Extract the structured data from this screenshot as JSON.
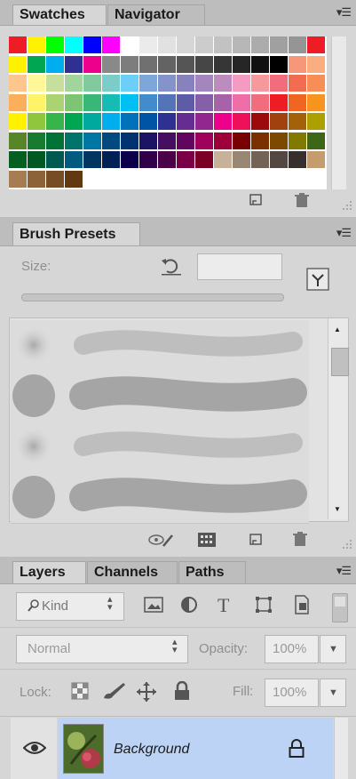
{
  "swatches_panel": {
    "tabs": [
      {
        "label": "Swatches"
      },
      {
        "label": "Navigator"
      }
    ],
    "menu_icon": "panel-menu-icon",
    "footer_icons": [
      "new-swatch-icon",
      "trash-icon"
    ],
    "colors": [
      [
        "#ee1c24",
        "#fff200",
        "#00ff00",
        "#00ffff",
        "#0000ff",
        "#ff00ff",
        "#ffffff",
        "#ebebeb",
        "#e1e1e1",
        "#d6d6d6",
        "#cccccc",
        "#c2c2c2",
        "#b7b7b7",
        "#acacac",
        "#a0a0a0",
        "#959595",
        "#ee1c24"
      ],
      [
        "#fff200",
        "#00a651",
        "#00aeef",
        "#2e3192",
        "#ec008c",
        "#898989",
        "#7d7d7d",
        "#707070",
        "#636363",
        "#555555",
        "#464646",
        "#363636",
        "#262626",
        "#111111",
        "#000000",
        "#f7977a",
        "#fbad82"
      ],
      [
        "#fdc68c",
        "#fff799",
        "#c6df9c",
        "#a4d49d",
        "#81ca9d",
        "#7bcdc9",
        "#6ccff7",
        "#7da7d8",
        "#8493ca",
        "#8781bd",
        "#a286bd",
        "#bc8cbf",
        "#f49bc1",
        "#f5999d",
        "#f16d7e",
        "#f26c4f",
        "#f68e55"
      ],
      [
        "#fbaf5a",
        "#fff467",
        "#acd372",
        "#7dc473",
        "#39b778",
        "#16bcb4",
        "#00bff3",
        "#438ccb",
        "#5573b7",
        "#5e5ca7",
        "#855fa8",
        "#a763a9",
        "#ef6ea8",
        "#f16d7e",
        "#ee1d24",
        "#f16522",
        "#f7941d"
      ],
      [
        "#fff100",
        "#8fc63d",
        "#37b44a",
        "#00a650",
        "#00a99e",
        "#00aeef",
        "#0072bc",
        "#0054a5",
        "#2f3192",
        "#652c91",
        "#91278f",
        "#ed008c",
        "#ee105a",
        "#9d0a0e",
        "#a1410d",
        "#a36209",
        "#aba000"
      ],
      [
        "#588528",
        "#197b30",
        "#007236",
        "#00736a",
        "#0076a4",
        "#004a80",
        "#003370",
        "#1d1363",
        "#450e61",
        "#62055f",
        "#9e005c",
        "#9d0039",
        "#790000",
        "#7b3000",
        "#7c4900",
        "#827a00",
        "#3e6617"
      ],
      [
        "#045f20",
        "#005824",
        "#005951",
        "#005b7e",
        "#003562",
        "#002056",
        "#0c004b",
        "#30004a",
        "#4b0048",
        "#7a0045",
        "#7a0026",
        "#c7b299",
        "#998675",
        "#736357",
        "#534741",
        "#37302d",
        "#c69c6e"
      ],
      [
        "#a67c52",
        "#8c6239",
        "#754c24",
        "#603913"
      ]
    ]
  },
  "brush_panel": {
    "tab_label": "Brush Presets",
    "size_label": "Size:",
    "size_value": "",
    "icons": [
      "reset-icon",
      "brush-panel-toggle-icon"
    ],
    "footer_icons": [
      "brush-visibility-icon",
      "brush-grid-icon",
      "new-preset-icon",
      "trash-icon"
    ]
  },
  "layers_panel": {
    "tabs": [
      {
        "label": "Layers"
      },
      {
        "label": "Channels"
      },
      {
        "label": "Paths"
      }
    ],
    "filter_label": "Kind",
    "blend_mode": "Normal",
    "opacity_label": "Opacity:",
    "opacity_value": "100%",
    "lock_label": "Lock:",
    "fill_label": "Fill:",
    "fill_value": "100%",
    "layer_name": "Background"
  }
}
